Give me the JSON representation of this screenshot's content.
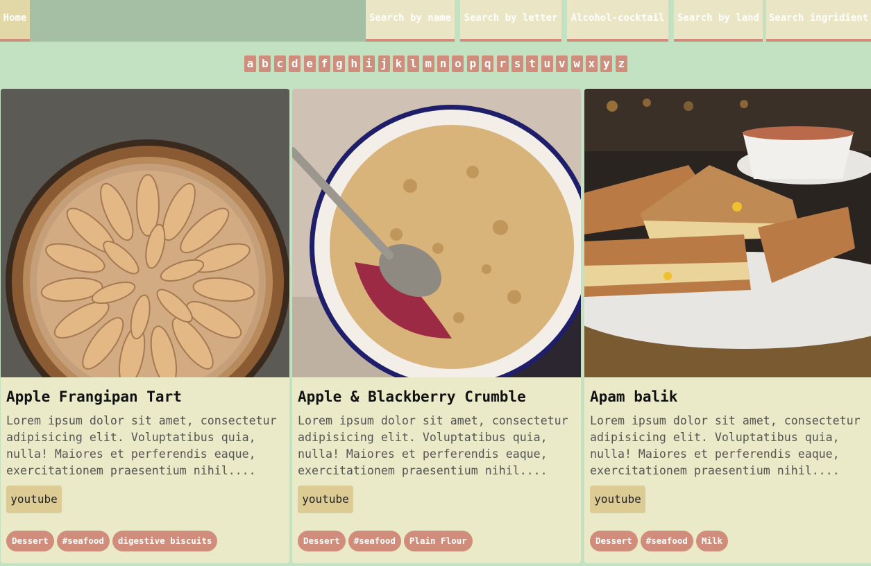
{
  "nav": {
    "home": "Home",
    "items": [
      {
        "label": "Search by name"
      },
      {
        "label": "Search by letter"
      },
      {
        "label": "Alcohol-cocktail"
      },
      {
        "label": "Search by land"
      },
      {
        "label": "Search ingridient"
      }
    ]
  },
  "letters": [
    "a",
    "b",
    "c",
    "d",
    "e",
    "f",
    "g",
    "h",
    "i",
    "j",
    "k",
    "l",
    "m",
    "n",
    "o",
    "p",
    "q",
    "r",
    "s",
    "t",
    "u",
    "v",
    "w",
    "x",
    "y",
    "z"
  ],
  "cards": [
    {
      "title": "Apple Frangipan Tart",
      "description": "Lorem ipsum dolor sit amet, consectetur adipisicing elit. Voluptatibus quia, nulla! Maiores et perferendis eaque, exercitationem praesentium nihil....",
      "youtube_label": "youtube",
      "tags": [
        "Dessert",
        "#seafood",
        "digestive biscuits"
      ],
      "image_icon": "tart-photo"
    },
    {
      "title": "Apple & Blackberry Crumble",
      "description": "Lorem ipsum dolor sit amet, consectetur adipisicing elit. Voluptatibus quia, nulla! Maiores et perferendis eaque, exercitationem praesentium nihil....",
      "youtube_label": "youtube",
      "tags": [
        "Dessert",
        "#seafood",
        "Plain Flour"
      ],
      "image_icon": "crumble-photo"
    },
    {
      "title": "Apam balik",
      "description": "Lorem ipsum dolor sit amet, consectetur adipisicing elit. Voluptatibus quia, nulla! Maiores et perferendis eaque, exercitationem praesentium nihil....",
      "youtube_label": "youtube",
      "tags": [
        "Dessert",
        "#seafood",
        "Milk"
      ],
      "image_icon": "pancake-photo"
    }
  ],
  "colors": {
    "background": "#c3e2c2",
    "nav_button": "#eae5c4",
    "accent": "#d18d7c",
    "card": "#eae9c8",
    "youtube_button": "#dccb93"
  }
}
